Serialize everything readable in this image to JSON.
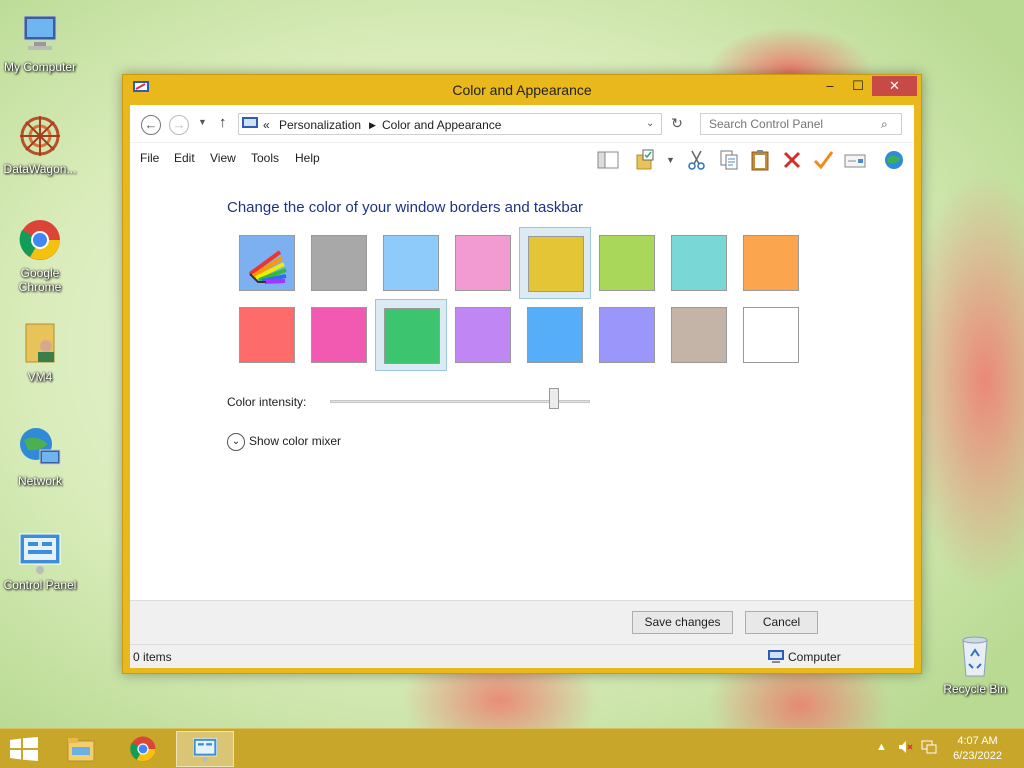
{
  "desktop": {
    "icons": [
      {
        "label": "My Computer",
        "icon": "computer-icon"
      },
      {
        "label": "DataWagon...",
        "icon": "datawagon-icon"
      },
      {
        "label": "Google Chrome",
        "icon": "chrome-icon"
      },
      {
        "label": "VM4",
        "icon": "user-folder-icon"
      },
      {
        "label": "Network",
        "icon": "network-icon"
      },
      {
        "label": "Control Panel",
        "icon": "control-panel-icon"
      },
      {
        "label": "Recycle Bin",
        "icon": "recycle-bin-icon"
      }
    ]
  },
  "window": {
    "title": "Color and Appearance",
    "controls": {
      "minimize": "–",
      "maximize": "☐",
      "close": "✕"
    },
    "address": {
      "prefix": "«",
      "crumbs": [
        "Personalization",
        "Color and Appearance"
      ],
      "refresh": "↻"
    },
    "search": {
      "placeholder": "Search Control Panel"
    },
    "menu": [
      "File",
      "Edit",
      "View",
      "Tools",
      "Help"
    ],
    "heading": "Change the color of your window borders and taskbar",
    "swatches_row1": [
      "auto",
      "#a8a8a8",
      "#8ecbfa",
      "#f29ad2",
      "#e4c536",
      "#a9d75a",
      "#79d8d6",
      "#fba64e"
    ],
    "swatches_row2": [
      "#fd6b6b",
      "#f15ab0",
      "#3cc46e",
      "#bf86f4",
      "#56aef9",
      "#9b96f9",
      "#c3b4a7",
      "#ffffff"
    ],
    "selected_swatches": [
      "row1-5",
      "row2-3"
    ],
    "intensity_label": "Color intensity:",
    "intensity_value": 0.86,
    "mixer_label": "Show color mixer",
    "buttons": {
      "save": "Save changes",
      "cancel": "Cancel"
    },
    "status": {
      "items": "0 items",
      "location": "Computer"
    }
  },
  "taskbar": {
    "time": "4:07 AM",
    "date": "6/23/2022",
    "apps": [
      "file-explorer-icon",
      "chrome-icon",
      "control-panel-icon"
    ]
  },
  "colors": {
    "accent": "#e8b81c",
    "taskbar": "#c7a62a",
    "heading": "#1e3287"
  }
}
